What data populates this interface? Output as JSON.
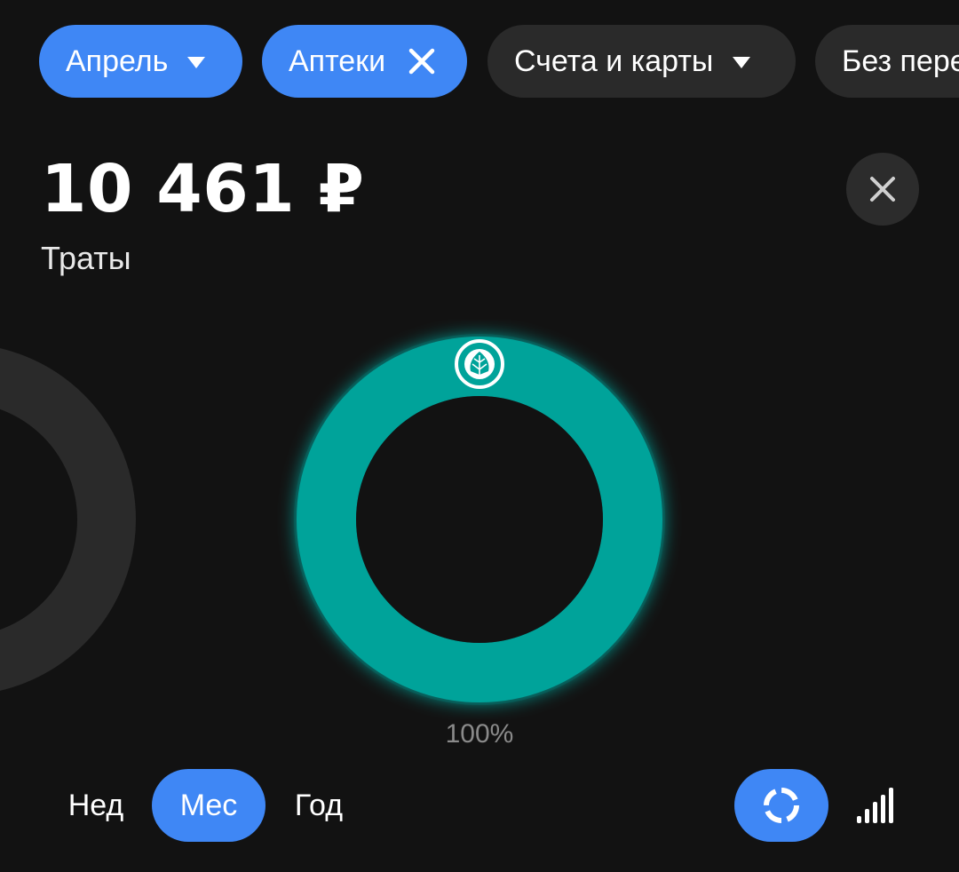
{
  "filters": {
    "month": {
      "label": "Апрель",
      "icon": "dropdown-triangle-icon"
    },
    "category": {
      "label": "Аптеки",
      "icon": "close-icon"
    },
    "accounts": {
      "label": "Счета и карты",
      "icon": "dropdown-triangle-icon"
    },
    "transfers": {
      "label": "Без переводов"
    }
  },
  "summary": {
    "amount": "10 461 ₽",
    "label": "Траты",
    "close_icon": "close-icon"
  },
  "chart_data": {
    "type": "pie",
    "categories": [
      "Аптеки"
    ],
    "values": [
      100
    ],
    "value_label": "100%",
    "colors": {
      "segment": "#00a39a",
      "inactive_ring": "#2a2a2a"
    },
    "segment_icon": "pharmacy-leaf-icon"
  },
  "period": {
    "options": [
      "Нед",
      "Мес",
      "Год"
    ],
    "selected": "Мес"
  },
  "view_toggle": {
    "donut_icon": "donut-chart-icon",
    "bars_icon": "bar-chart-icon",
    "selected": "donut"
  },
  "colors": {
    "background": "#121212",
    "accent": "#3f87f5",
    "chip_dark": "#2a2a2a",
    "teal": "#00a39a"
  }
}
